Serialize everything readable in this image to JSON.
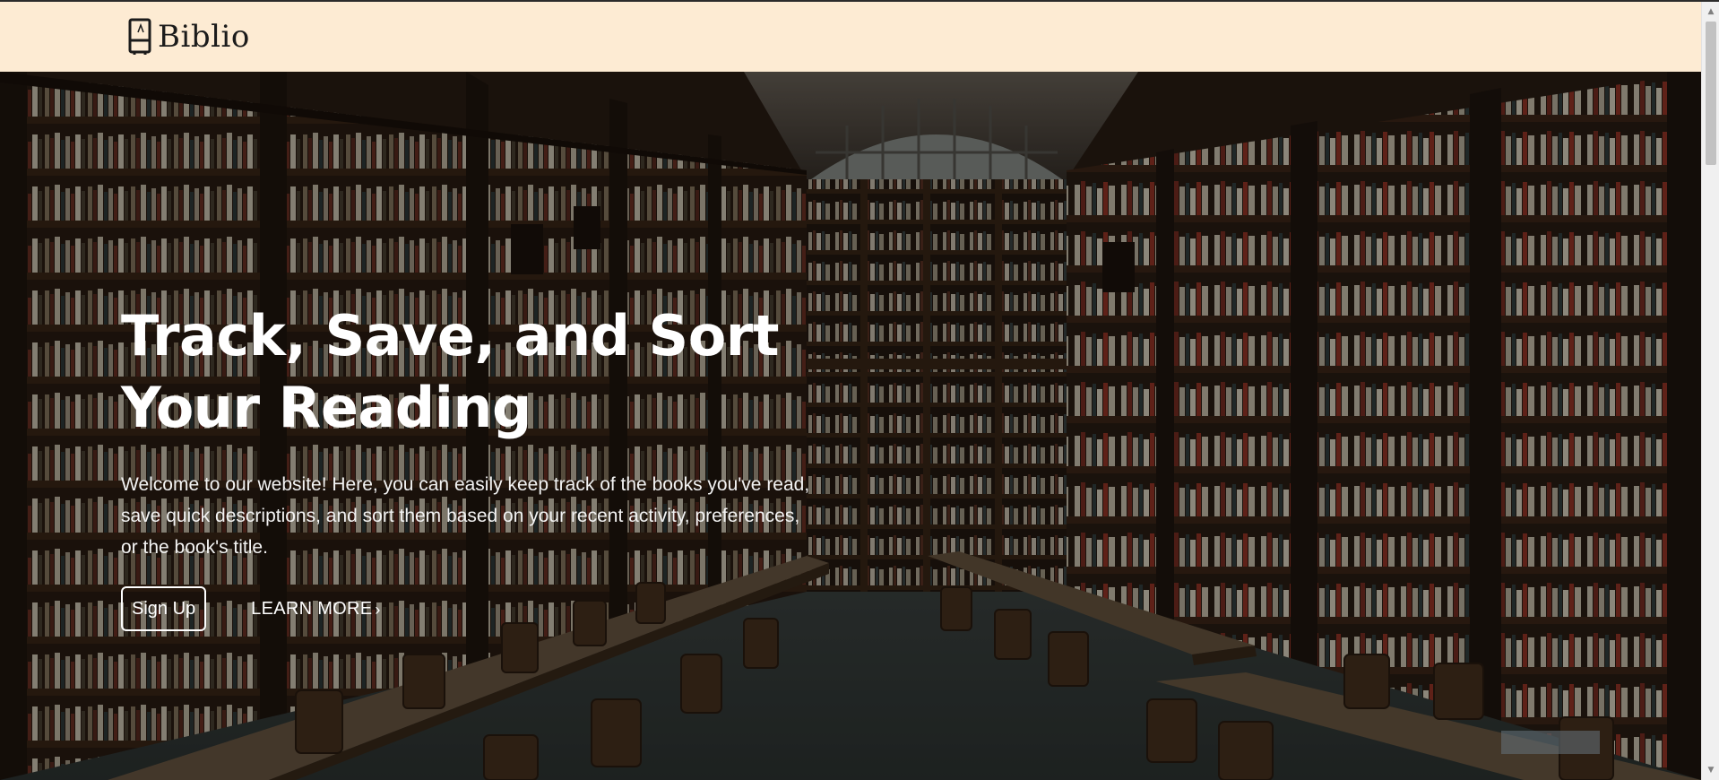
{
  "header": {
    "brand": "Biblio",
    "logo_icon": "book-stand-icon",
    "background": "#fdebd3"
  },
  "hero": {
    "background_icon": "library-photo",
    "title": "Track, Save, and Sort Your Reading",
    "description": "Welcome to our website! Here, you can easily keep track of the books you've read, save quick descriptions, and sort them based on your recent activity, preferences, or the book's title.",
    "signup_label": "Sign Up",
    "learn_more_label": "LEARN MORE",
    "learn_more_icon": "chevron-right-icon"
  },
  "scrollbar": {
    "up_icon": "scroll-up-arrow-icon",
    "down_icon": "scroll-down-arrow-icon"
  },
  "colors": {
    "header_bg": "#fdebd3",
    "hero_text": "#ffffff",
    "brand_text": "#1b1b1b"
  }
}
